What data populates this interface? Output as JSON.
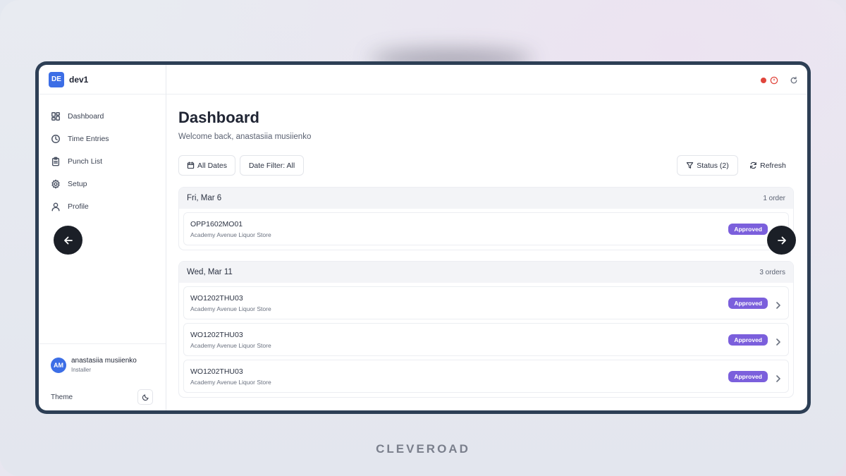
{
  "app": {
    "badge": "DE",
    "name": "dev1"
  },
  "sidebar": {
    "items": [
      {
        "label": "Dashboard",
        "icon": "grid-icon"
      },
      {
        "label": "Time Entries",
        "icon": "clock-icon"
      },
      {
        "label": "Punch List",
        "icon": "clipboard-icon"
      },
      {
        "label": "Setup",
        "icon": "gear-icon"
      },
      {
        "label": "Profile",
        "icon": "user-icon"
      }
    ],
    "user": {
      "initials": "AM",
      "name": "anastasiia musiienko",
      "role": "Installer"
    },
    "theme_label": "Theme"
  },
  "main": {
    "title": "Dashboard",
    "welcome": "Welcome back, anastasiia musiienko",
    "filters": {
      "all_dates": "All Dates",
      "date_filter": "Date Filter: All",
      "status": "Status (2)",
      "refresh": "Refresh"
    },
    "groups": [
      {
        "date": "Fri, Mar 6",
        "count": "1 order",
        "orders": [
          {
            "id": "OPP1602MO01",
            "store": "Academy Avenue Liquor Store",
            "status": "Approved"
          }
        ]
      },
      {
        "date": "Wed, Mar 11",
        "count": "3 orders",
        "orders": [
          {
            "id": "WO1202THU03",
            "store": "Academy Avenue Liquor Store",
            "status": "Approved"
          },
          {
            "id": "WO1202THU03",
            "store": "Academy Avenue Liquor Store",
            "status": "Approved"
          },
          {
            "id": "WO1202THU03",
            "store": "Academy Avenue Liquor Store",
            "status": "Approved"
          }
        ]
      }
    ]
  },
  "colors": {
    "accent": "#3c6ee6",
    "approved_badge": "#7b5fdc",
    "error_dot": "#e0453c",
    "frame": "#2d3f55"
  },
  "watermark": "CLEVEROAD"
}
